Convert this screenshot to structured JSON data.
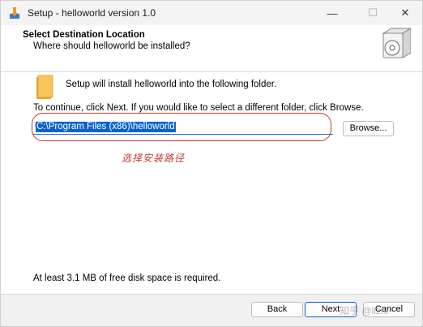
{
  "window": {
    "title": "Setup - helloworld version 1.0",
    "min_glyph": "—",
    "max_glyph": "☐",
    "close_glyph": "✕"
  },
  "header": {
    "title": "Select Destination Location",
    "subtitle": "Where should helloworld be installed?"
  },
  "body": {
    "install_text": "Setup will install helloworld into the following folder.",
    "continue_text": "To continue, click Next. If you would like to select a different folder, click Browse.",
    "path_value": "C:\\Program Files (x86)\\helloworld",
    "browse_label": "Browse...",
    "annotation": "选择安装路径",
    "disk_space_text": "At least 3.1 MB of free disk space is required."
  },
  "footer": {
    "back_label": "Back",
    "next_label": "Next",
    "cancel_label": "Cancel"
  },
  "watermark": "知乎 @lizhr",
  "colors": {
    "accent": "#0b63ce",
    "annotation": "#c0392b",
    "folder": "#f2b94a"
  }
}
